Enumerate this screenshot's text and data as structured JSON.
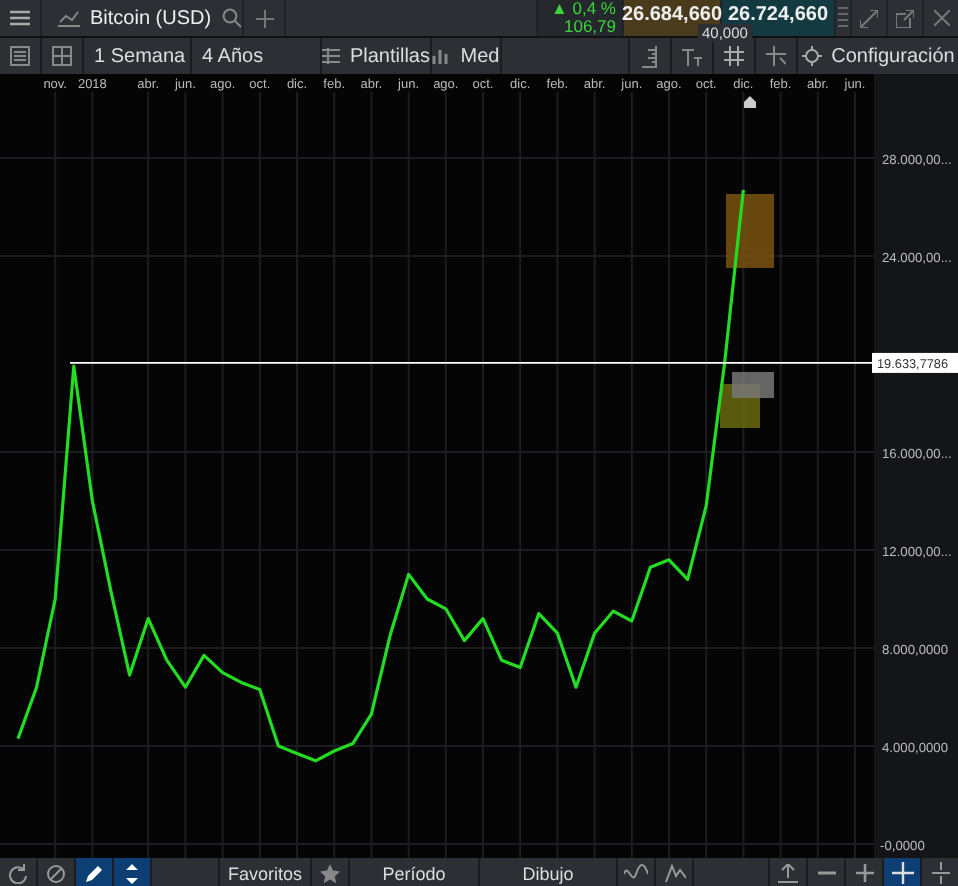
{
  "instrument": {
    "name": "Bitcoin (USD)"
  },
  "quote": {
    "change_pct": "▲ 0,4 %",
    "change": "106,79",
    "sell": "26.684,660",
    "buy": "26.724,660",
    "spread": "40,000"
  },
  "chart_toolbar": {
    "interval": "1 Semana",
    "range": "4 Años",
    "templates": "Plantillas",
    "studies": "Med",
    "settings": "Configuración"
  },
  "chart": {
    "chart_data": {
      "type": "line",
      "grid": true,
      "ylim": [
        -570,
        30690
      ],
      "categories": [
        null,
        null,
        "nov.",
        null,
        "2018",
        null,
        null,
        "abr.",
        null,
        "jun.",
        null,
        "ago.",
        null,
        "oct.",
        null,
        "dic.",
        null,
        "feb.",
        null,
        "abr.",
        null,
        "jun.",
        null,
        "ago.",
        null,
        "oct.",
        null,
        "dic.",
        null,
        "feb.",
        null,
        "abr.",
        null,
        "jun.",
        null,
        "ago.",
        null,
        "oct.",
        null,
        "dic.",
        null,
        "feb.",
        null,
        "abr.",
        null,
        "jun."
      ],
      "yticks": [
        {
          "value": 0,
          "label": "-0,0000"
        },
        {
          "value": 4000,
          "label": "4.000,0000"
        },
        {
          "value": 8000,
          "label": "8.000,0000"
        },
        {
          "value": 12000,
          "label": "12.000,00..."
        },
        {
          "value": 16000,
          "label": "16.000,00..."
        },
        {
          "value": 24000,
          "label": "24.000,00..."
        },
        {
          "value": 28000,
          "label": "28.000,00..."
        }
      ],
      "series": [
        {
          "color": "#22dd22",
          "values": [
            4300,
            6400,
            10000,
            19500,
            14000,
            10300,
            6900,
            9200,
            7500,
            6400,
            7700,
            7000,
            6600,
            6300,
            4000,
            3700,
            3400,
            3800,
            4100,
            5300,
            8500,
            11000,
            10000,
            9600,
            8300,
            9200,
            7500,
            7200,
            9400,
            8600,
            6400,
            8600,
            9500,
            9100,
            11300,
            11600,
            10800,
            13800,
            19700,
            26700,
            null,
            null,
            null,
            null,
            null,
            null
          ]
        }
      ],
      "ref_lines": [
        {
          "axis": "y",
          "value": 19633.7786,
          "label": "19.633,7786"
        }
      ]
    }
  },
  "bottom_bar": {
    "left_tools": [
      {
        "kind": "refresh",
        "selected": false
      },
      {
        "kind": "cancel",
        "selected": false
      },
      {
        "kind": "pencil",
        "selected": true
      },
      {
        "kind": "arrows",
        "selected": true
      }
    ],
    "tabs": [
      {
        "label": "Favoritos"
      },
      {
        "label": "Período"
      },
      {
        "label": "Dibujo"
      }
    ],
    "zoom_tools": [
      {
        "kind": "fit",
        "selected": false
      },
      {
        "kind": "minus",
        "selected": false
      },
      {
        "kind": "plus",
        "selected": false
      },
      {
        "kind": "crosshair",
        "selected": true
      },
      {
        "kind": "split",
        "selected": false
      }
    ]
  }
}
